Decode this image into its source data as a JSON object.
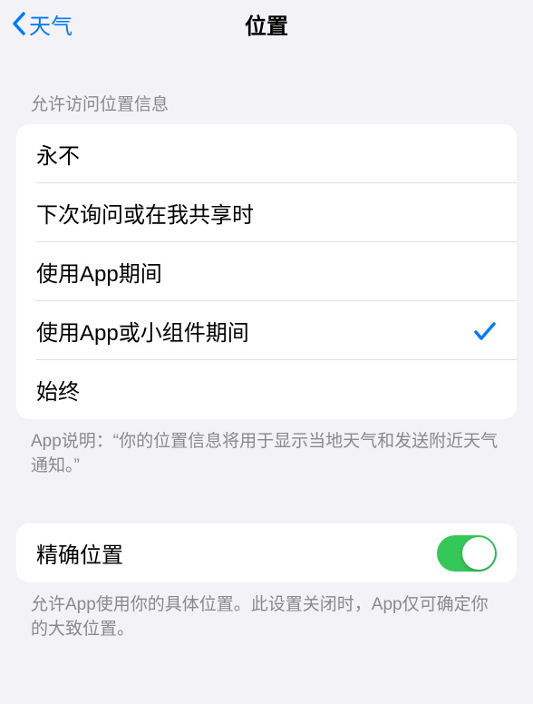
{
  "nav": {
    "back_label": "天气",
    "title": "位置"
  },
  "section1": {
    "header": "允许访问位置信息",
    "options": {
      "never": "永不",
      "ask": "下次询问或在我共享时",
      "while_using": "使用App期间",
      "while_using_widget": "使用App或小组件期间",
      "always": "始终"
    },
    "footer": "App说明：“你的位置信息将用于显示当地天气和发送附近天气通知。”"
  },
  "section2": {
    "precise_label": "精确位置",
    "precise_enabled": true,
    "footer": "允许App使用你的具体位置。此设置关闭时，App仅可确定你的大致位置。"
  }
}
